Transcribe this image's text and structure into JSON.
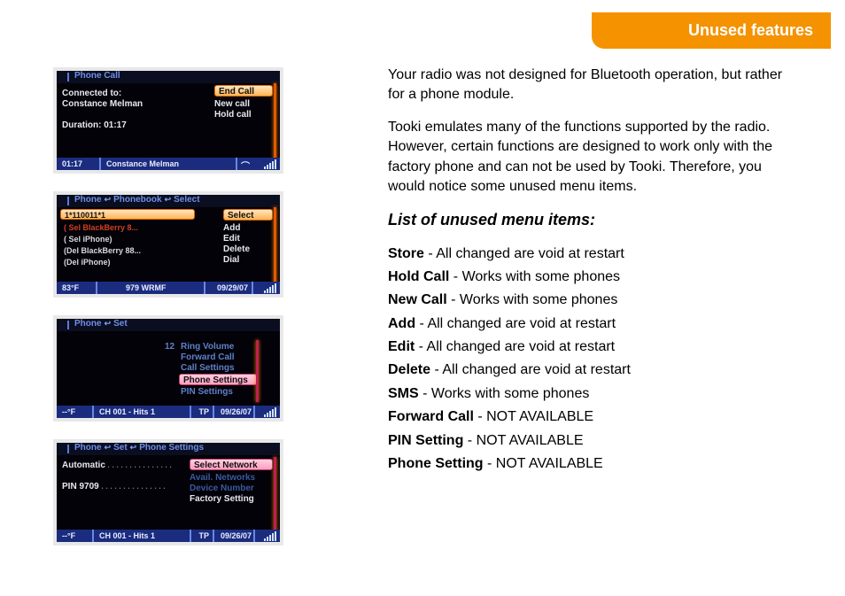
{
  "header": {
    "title": "Unused features"
  },
  "shots": {
    "s1": {
      "title": "Phone Call",
      "connected_label": "Connected to:",
      "connected_name": "Constance Melman",
      "duration_label": "Duration: 01:17",
      "menu_hl": "End Call",
      "menu_items": [
        "New call",
        "Hold call"
      ],
      "status_left": "01:17",
      "status_mid": "Constance Melman"
    },
    "s2": {
      "title_parts": [
        "Phone",
        "Phonebook",
        "Select"
      ],
      "rows": [
        {
          "text": "1*110011*1",
          "sel": true
        },
        {
          "text": "( Sel BlackBerry 8...",
          "red": true
        },
        {
          "text": "( Sel iPhone)"
        },
        {
          "text": "(Del BlackBerry 88..."
        },
        {
          "text": "(Del iPhone)"
        }
      ],
      "menu_hl": "Select",
      "menu_items": [
        "Add",
        "Edit",
        "Delete",
        "Dial"
      ],
      "status_left": "83°F",
      "status_mid": "979 WRMF",
      "status_right": "09/29/07"
    },
    "s3": {
      "title_parts": [
        "Phone",
        "Set"
      ],
      "num": "12",
      "items_blue": [
        "Ring Volume",
        "Forward Call",
        "Call Settings"
      ],
      "item_hl": "Phone Settings",
      "items_blue2": [
        "PIN Settings"
      ],
      "status_left": "--°F",
      "status_mid": "CH 001 - Hits 1",
      "status_tp": "TP",
      "status_right": "09/26/07"
    },
    "s4": {
      "title_parts": [
        "Phone",
        "Set",
        "Phone Settings"
      ],
      "left_items": [
        "Automatic",
        "PIN 9709"
      ],
      "menu_hl": "Select Network",
      "items_dim": [
        "Avail. Networks",
        "Device Number"
      ],
      "item_white": "Factory Setting",
      "status_left": "--°F",
      "status_mid": "CH 001 - Hits 1",
      "status_tp": "TP",
      "status_right": "09/26/07"
    }
  },
  "text": {
    "p1a": "Your  radio was not designed for Bluetooth operation, but rather",
    "p1b": "for a                 phone module.",
    "p2": "Tooki emulates many of the functions supported by the radio. However, certain functions are designed to work only with the factory phone and can not be used by Tooki. Therefore, you would notice some unused menu items.",
    "heading": "List of unused menu items:",
    "items": [
      {
        "b": "Store",
        "rest": " - All changed are void at restart"
      },
      {
        "b": "Hold Call",
        "rest": " - Works with some phones"
      },
      {
        "b": "New Call",
        "rest": " - Works with some phones"
      },
      {
        "b": "Add",
        "rest": " - All changed are void at restart"
      },
      {
        "b": "Edit",
        "rest": " - All changed are void at restart"
      },
      {
        "b": "Delete",
        "rest": " - All changed are void at restart"
      },
      {
        "b": "SMS",
        "rest": " - Works with some phones"
      },
      {
        "b": "Forward Call",
        "rest": " - NOT AVAILABLE"
      },
      {
        "b": "PIN Setting",
        "rest": " - NOT AVAILABLE"
      },
      {
        "b": "Phone Setting",
        "rest": " - NOT AVAILABLE"
      }
    ]
  }
}
